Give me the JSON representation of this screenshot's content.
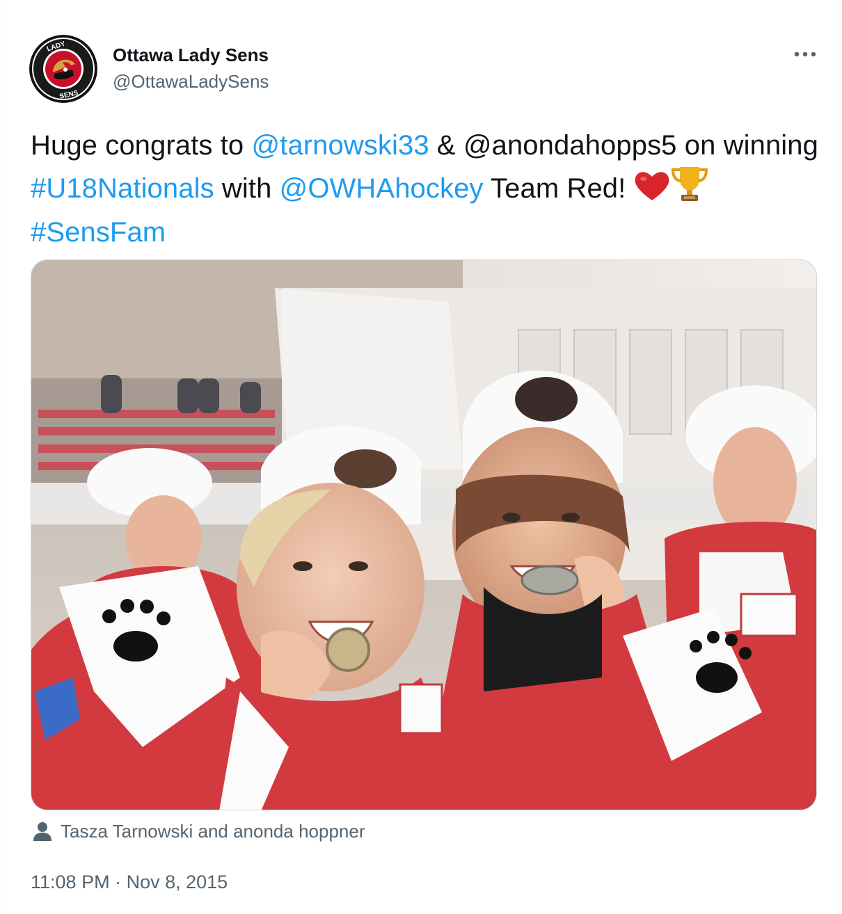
{
  "tweet": {
    "author": {
      "display_name": "Ottawa Lady Sens",
      "handle": "@OttawaLadySens",
      "avatar_text_top": "LADY",
      "avatar_text_bottom": "SENS"
    },
    "more_icon": "more-horizontal-icon",
    "text_segments": [
      {
        "type": "text",
        "value": "Huge congrats to "
      },
      {
        "type": "mention",
        "value": "@tarnowski33"
      },
      {
        "type": "text",
        "value": " & @anondahopps5 on winning "
      },
      {
        "type": "hashtag",
        "value": "#U18Nationals"
      },
      {
        "type": "text",
        "value": " with "
      },
      {
        "type": "mention",
        "value": "@OWHAhockey"
      },
      {
        "type": "text",
        "value": " Team Red! "
      },
      {
        "type": "emoji",
        "value": "red-heart-icon"
      },
      {
        "type": "emoji",
        "value": "trophy-icon"
      },
      {
        "type": "text",
        "value": " "
      },
      {
        "type": "hashtag",
        "value": "#SensFam"
      }
    ],
    "media": {
      "kind": "photo",
      "description_icon": "photo"
    },
    "tagged_people": "Tasza Tarnowski and anonda hoppner",
    "time": "11:08 PM",
    "separator": " · ",
    "date": "Nov 8, 2015"
  },
  "colors": {
    "link": "#1d9bf0",
    "text": "#0f1419",
    "secondary": "#536471",
    "jersey_red": "#d23a3f"
  }
}
